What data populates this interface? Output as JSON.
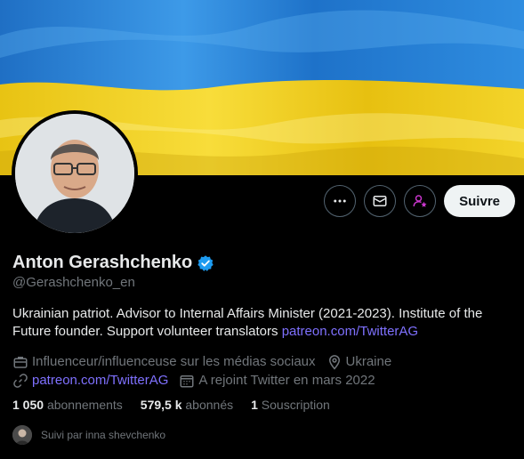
{
  "profile": {
    "name": "Anton Gerashchenko",
    "handle": "@Gerashchenko_en",
    "bio_text": "Ukrainian patriot. Advisor to Internal Affairs Minister (2021-2023). Institute of the Future founder. Support volunteer translators ",
    "bio_link": "patreon.com/TwitterAG",
    "category": "Influenceur/influenceuse sur les médias sociaux",
    "location": "Ukraine",
    "website": "patreon.com/TwitterAG",
    "joined": "A rejoint Twitter en mars 2022",
    "verified_color": "#1d9bf0"
  },
  "actions": {
    "more_icon": "more-icon",
    "message_icon": "envelope-icon",
    "subscribe_icon": "subscribe-star-person-icon",
    "follow_label": "Suivre"
  },
  "stats": {
    "following_count": "1 050",
    "following_label": "abonnements",
    "followers_count": "579,5 k",
    "followers_label": "abonnés",
    "subscriptions_count": "1",
    "subscriptions_label": "Souscription"
  },
  "followed_by": {
    "text": "Suivi par inna shevchenko"
  },
  "banner": {
    "top_color": "#2d8be0",
    "bottom_color": "#f5d21c"
  }
}
